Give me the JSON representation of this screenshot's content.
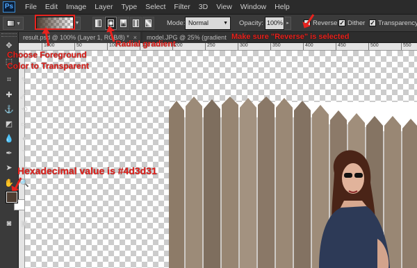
{
  "app": {
    "logo": "Ps",
    "menu": [
      "File",
      "Edit",
      "Image",
      "Layer",
      "Type",
      "Select",
      "Filter",
      "3D",
      "View",
      "Window",
      "Help"
    ]
  },
  "options": {
    "mode_label": "Mode:",
    "mode_value": "Normal",
    "opacity_label": "Opacity:",
    "opacity_value": "100%",
    "reverse_label": "Reverse",
    "dither_label": "Dither",
    "transparency_label": "Transparency",
    "reverse_checked": true,
    "dither_checked": true,
    "transparency_checked": true,
    "gradient_types": [
      "linear",
      "radial",
      "angle",
      "reflected",
      "diamond"
    ],
    "active_gradient": "radial"
  },
  "tabs": [
    {
      "label": "result.psd @ 100% (Layer 1, RGB/8) *",
      "close": "×"
    },
    {
      "label": "model.JPG @ 25% (gradient",
      "close": "×"
    }
  ],
  "ruler": [
    "1000",
    "50",
    "100",
    "150",
    "200",
    "250",
    "300",
    "350",
    "400",
    "450",
    "500",
    "550"
  ],
  "colors": {
    "foreground": "#4d3d31",
    "background": "#ffffff",
    "annotation": "#e8231e"
  },
  "annotations": {
    "foreground_to_transparent": [
      "Choose Foreground",
      "Color to Transparent"
    ],
    "radial": "Radial gradient",
    "reverse": "Make sure \"Reverse\" is selected",
    "hex": "Hexadecimal value is #4d3d31"
  }
}
